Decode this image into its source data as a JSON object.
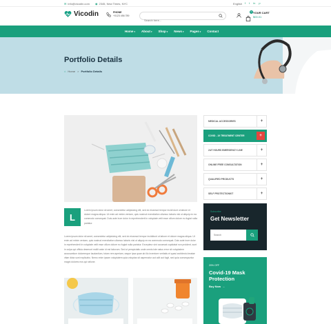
{
  "topbar": {
    "email": "info@vicodin.com",
    "address": "2345, New Times, NYC",
    "language": "English",
    "socials": [
      "f",
      "t",
      "in",
      "p"
    ]
  },
  "header": {
    "brand": "Vicodin",
    "phone_label": "PHONE",
    "phone_number": "+0123 456 789",
    "search_placeholder": "Search here...",
    "cart_label": "YOUR CART",
    "cart_total": "$00.01",
    "cart_count": "0"
  },
  "nav": {
    "items": [
      {
        "label": "Home"
      },
      {
        "label": "About"
      },
      {
        "label": "Shop"
      },
      {
        "label": "News"
      },
      {
        "label": "Pages"
      },
      {
        "label": "Contact"
      }
    ]
  },
  "hero": {
    "title": "Portfolio Details",
    "breadcrumb_home": "Home",
    "breadcrumb_sep": ">",
    "breadcrumb_current": "Portfolio Details"
  },
  "categories": [
    {
      "label": "MEDICAL ACCESSORIES",
      "active": false
    },
    {
      "label": "COVID - 19 TREATMENT CENTER",
      "active": true
    },
    {
      "label": "24/7 HOURS EMERGENCY LINE",
      "active": false
    },
    {
      "label": "ONLINE FREE CONSULTATION",
      "active": false
    },
    {
      "label": "QUALIFIED PRODUCTS",
      "active": false
    },
    {
      "label": "SELF PROTECTIONKIT",
      "active": false
    }
  ],
  "article": {
    "dropcap": "L",
    "para1": "Lorem ipsum dolor sit amet, consectetur adipisicing elit, sed do eiusmod tempor incidi dunt ut labore et dolore magna aliqua. Ut enim ad minim veniam, quis nostrud exercitation ullamco laboris nisi ut aliquip ex ea commodo consequat. Duis aute irure dolor in reprehenderit in voluptate velit esse cillum dolore eu fugiat nulla pariatur.",
    "para2": "Lorem ipsum dolor sit amet, consectetur adipisicing elit, sed do eiusmod tempor incididunt ut labore et dolore magna aliqua. Ut enim ad minim veniam, quis nostrud exercitation ullamco laboris nisi ut aliquip ex ea commodo consequat. Duis aute irure dolor in reprehenderit in voluptate velit esse cillum dolore eu fugiat nulla pariatur. Excepteur sint occaecat cupidatat non proident, sunt in culpa qui officia deserunt mollit anim id est laborum. Sed ut perspiciatis unde omnis iste natus error sit voluptatem accusantium doloremque laudantium, totam rem aperiam, eaque ipsa quae ab illo inventore veritatis et quasi architecto beatae vitae dicta sunt explicabo. Nemo enim ipsam voluptatem quia voluptas sit aspernatur aut odit aut fugit, sed quia consequuntur magni dolores eos qui ratione."
  },
  "newsletter": {
    "subtitle": "Subscribe",
    "title": "Get Newsletter",
    "placeholder": "Search"
  },
  "promo": {
    "subtitle": "20% OFF",
    "title": "Covid-19 Mask Protection",
    "button": "Buy Now"
  },
  "colors": {
    "primary": "#1aa07d",
    "danger": "#e5463f",
    "dark": "#18262c",
    "hero_bg": "#bfdde6"
  }
}
